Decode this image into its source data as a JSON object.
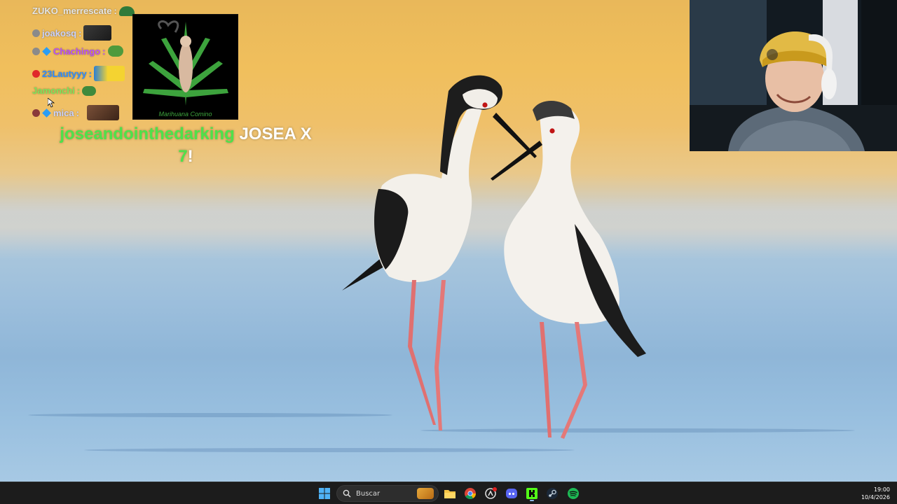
{
  "chat": {
    "lines": [
      {
        "name": "ZUKO_merrescate",
        "color": "#e5e5e5"
      },
      {
        "name": "joakosq",
        "color": "#c9d2ff"
      },
      {
        "name": "Chachingo",
        "color": "#b84dff"
      },
      {
        "name": "23Lautyyy",
        "color": "#2c8cff"
      },
      {
        "name": "Jamonchi",
        "color": "#7ee45c"
      },
      {
        "name": "mica",
        "color": "#c9d2ff"
      }
    ],
    "big_emote_caption": "Marihuana Comino"
  },
  "alert": {
    "user": "joseandointhedarking",
    "message": "JOSEA X",
    "count": "7",
    "exclaim": "!"
  },
  "taskbar": {
    "search_placeholder": "Buscar",
    "time": "19:00",
    "date": "10/4/2026",
    "icons": [
      "windows-start-icon",
      "search-icon",
      "file-explorer-icon",
      "chrome-icon",
      "app-icon",
      "discord-icon",
      "kick-icon",
      "steam-icon",
      "spotify-icon"
    ]
  }
}
